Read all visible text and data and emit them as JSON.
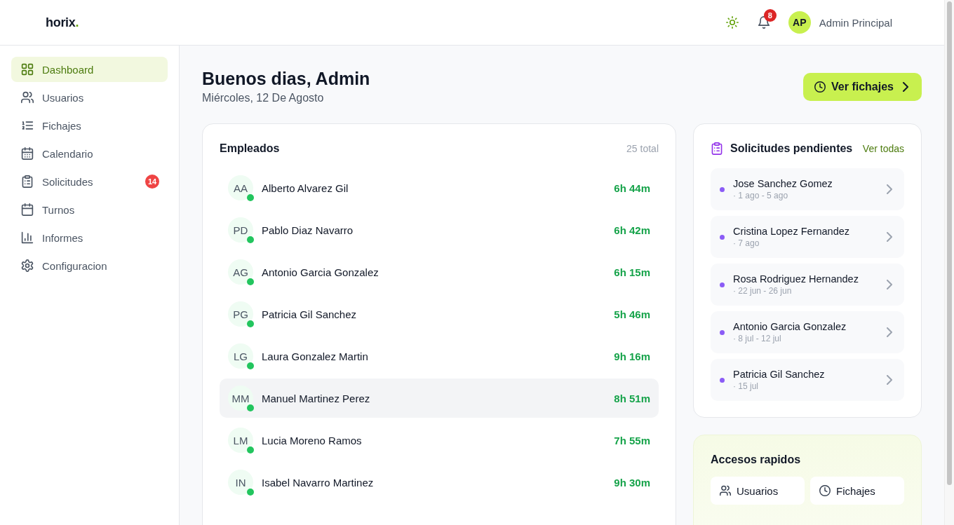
{
  "header": {
    "logo": {
      "text": "horix",
      "accent": "."
    },
    "notifications": {
      "count": "8"
    },
    "user": {
      "initials": "AP",
      "name": "Admin Principal"
    }
  },
  "sidebar": {
    "items": [
      {
        "label": "Dashboard",
        "selected": true
      },
      {
        "label": "Usuarios",
        "selected": false
      },
      {
        "label": "Fichajes",
        "selected": false
      },
      {
        "label": "Calendario",
        "selected": false
      },
      {
        "label": "Solicitudes",
        "selected": false,
        "badge": "14"
      },
      {
        "label": "Turnos",
        "selected": false
      },
      {
        "label": "Informes",
        "selected": false
      },
      {
        "label": "Configuracion",
        "selected": false
      }
    ]
  },
  "greeting": {
    "title": "Buenos dias, Admin",
    "date": "Miércoles, 12 De Agosto",
    "action": "Ver fichajes"
  },
  "employees": {
    "title": "Empleados",
    "total": "25 total",
    "rows": [
      {
        "initials": "AA",
        "name": "Alberto Alvarez Gil",
        "hours": "6h 44m",
        "online": true,
        "selected": false
      },
      {
        "initials": "PD",
        "name": "Pablo Diaz Navarro",
        "hours": "6h 42m",
        "online": true,
        "selected": false
      },
      {
        "initials": "AG",
        "name": "Antonio Garcia Gonzalez",
        "hours": "6h 15m",
        "online": true,
        "selected": false
      },
      {
        "initials": "PG",
        "name": "Patricia Gil Sanchez",
        "hours": "5h 46m",
        "online": true,
        "selected": false
      },
      {
        "initials": "LG",
        "name": "Laura Gonzalez Martin",
        "hours": "9h 16m",
        "online": true,
        "selected": false
      },
      {
        "initials": "MM",
        "name": "Manuel Martinez Perez",
        "hours": "8h 51m",
        "online": true,
        "selected": true
      },
      {
        "initials": "LM",
        "name": "Lucia Moreno Ramos",
        "hours": "7h 55m",
        "online": true,
        "selected": false
      },
      {
        "initials": "IN",
        "name": "Isabel Navarro Martinez",
        "hours": "9h 30m",
        "online": true,
        "selected": false
      }
    ]
  },
  "requests": {
    "title": "Solicitudes pendientes",
    "link": "Ver todas",
    "items": [
      {
        "name": "Jose Sanchez Gomez",
        "dates": "· 1 ago - 5 ago"
      },
      {
        "name": "Cristina Lopez Fernandez",
        "dates": "· 7 ago"
      },
      {
        "name": "Rosa Rodriguez Hernandez",
        "dates": "· 22 jun - 26 jun"
      },
      {
        "name": "Antonio Garcia Gonzalez",
        "dates": "· 8 jul - 12 jul"
      },
      {
        "name": "Patricia Gil Sanchez",
        "dates": "· 15 jul"
      }
    ]
  },
  "quick_access": {
    "title": "Accesos rapidos",
    "items": [
      {
        "label": "Usuarios"
      },
      {
        "label": "Fichajes"
      }
    ]
  }
}
